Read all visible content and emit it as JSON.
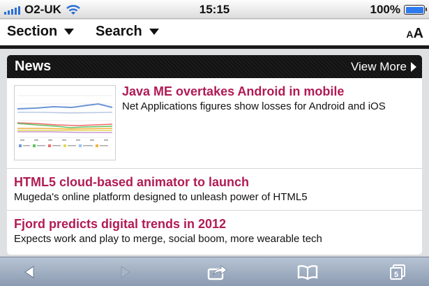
{
  "status_bar": {
    "carrier": "O2-UK",
    "time": "15:15",
    "battery": "100%",
    "battery_level": 1.0,
    "icons": [
      "signal-icon",
      "wifi-icon",
      "battery-icon"
    ]
  },
  "header": {
    "section_label": "Section",
    "search_label": "Search",
    "text_size_small": "A",
    "text_size_large": "A"
  },
  "news": {
    "title": "News",
    "view_more": "View More",
    "items": [
      {
        "headline": "Java ME overtakes Android in mobile",
        "summary": "Net Applications figures show losses for Android and iOS",
        "has_thumbnail": true
      },
      {
        "headline": "HTML5 cloud-based animator to launch",
        "summary": "Mugeda's online platform designed to unleash power of HTML5"
      },
      {
        "headline": "Fjord predicts digital trends in 2012",
        "summary": "Expects work and play to merge, social boom, more wearable tech"
      }
    ]
  },
  "toolbar": {
    "pages_count": "5",
    "icons": [
      "back-icon",
      "forward-icon",
      "share-icon",
      "bookmarks-icon",
      "pages-icon"
    ]
  },
  "colors": {
    "headline": "#b11b53",
    "toolbar": "#9dabbe",
    "news_header": "#161616"
  }
}
